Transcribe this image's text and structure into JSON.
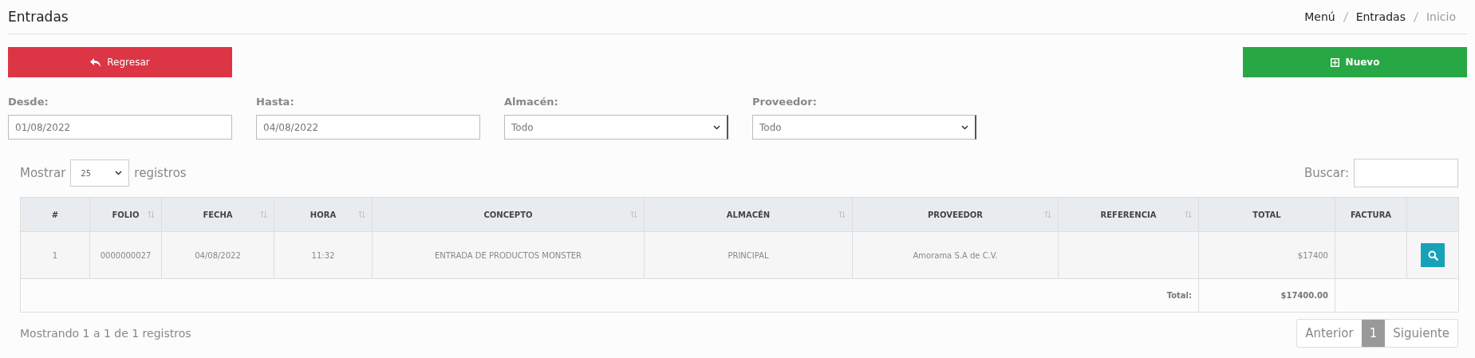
{
  "header": {
    "title": "Entradas",
    "breadcrumb": [
      {
        "label": "Menú",
        "current": false
      },
      {
        "label": "Entradas",
        "current": false
      },
      {
        "label": "Inicio",
        "current": true
      }
    ]
  },
  "buttons": [
    {
      "label": "Regresar",
      "kind": "back"
    },
    {
      "label": "Nuevo",
      "kind": "new"
    }
  ],
  "filters": [
    {
      "label": "Desde:",
      "kind": "text",
      "value": "01/08/2022"
    },
    {
      "label": "Hasta:",
      "kind": "text",
      "value": "04/08/2022"
    },
    {
      "label": "Almacén:",
      "kind": "select",
      "value": "Todo"
    },
    {
      "label": "Proveedor:",
      "kind": "select",
      "value": "Todo"
    }
  ],
  "length_menu": {
    "prefix": "Mostrar",
    "value": "25",
    "suffix": "registros"
  },
  "search": {
    "label": "Buscar:"
  },
  "table": {
    "columns": [
      {
        "label": "#",
        "sortable": false,
        "kind": "text"
      },
      {
        "label": "FOLIO",
        "sortable": true,
        "kind": "text"
      },
      {
        "label": "FECHA",
        "sortable": true,
        "kind": "text"
      },
      {
        "label": "HORA",
        "sortable": true,
        "kind": "text"
      },
      {
        "label": "CONCEPTO",
        "sortable": true,
        "kind": "text"
      },
      {
        "label": "ALMACÉN",
        "sortable": true,
        "kind": "text"
      },
      {
        "label": "PROVEEDOR",
        "sortable": true,
        "kind": "text"
      },
      {
        "label": "REFERENCIA",
        "sortable": true,
        "kind": "text"
      },
      {
        "label": "TOTAL",
        "sortable": false,
        "kind": "money"
      },
      {
        "label": "FACTURA",
        "sortable": false,
        "kind": "text"
      }
    ],
    "rows": [
      {
        "cells": [
          "1",
          "0000000027",
          "04/08/2022",
          "11:32",
          "ENTRADA DE PRODUCTOS MONSTER",
          "PRINCIPAL",
          "Amorama S.A de C.V.",
          "",
          "$17400",
          ""
        ]
      }
    ],
    "footer": {
      "label": "Total:",
      "value": "$17400.00"
    }
  },
  "info": "Mostrando 1 a 1 de 1 registros",
  "pagination": {
    "previous": "Anterior",
    "pages": [
      {
        "label": "1",
        "selected": true
      }
    ],
    "next": "Siguiente"
  }
}
